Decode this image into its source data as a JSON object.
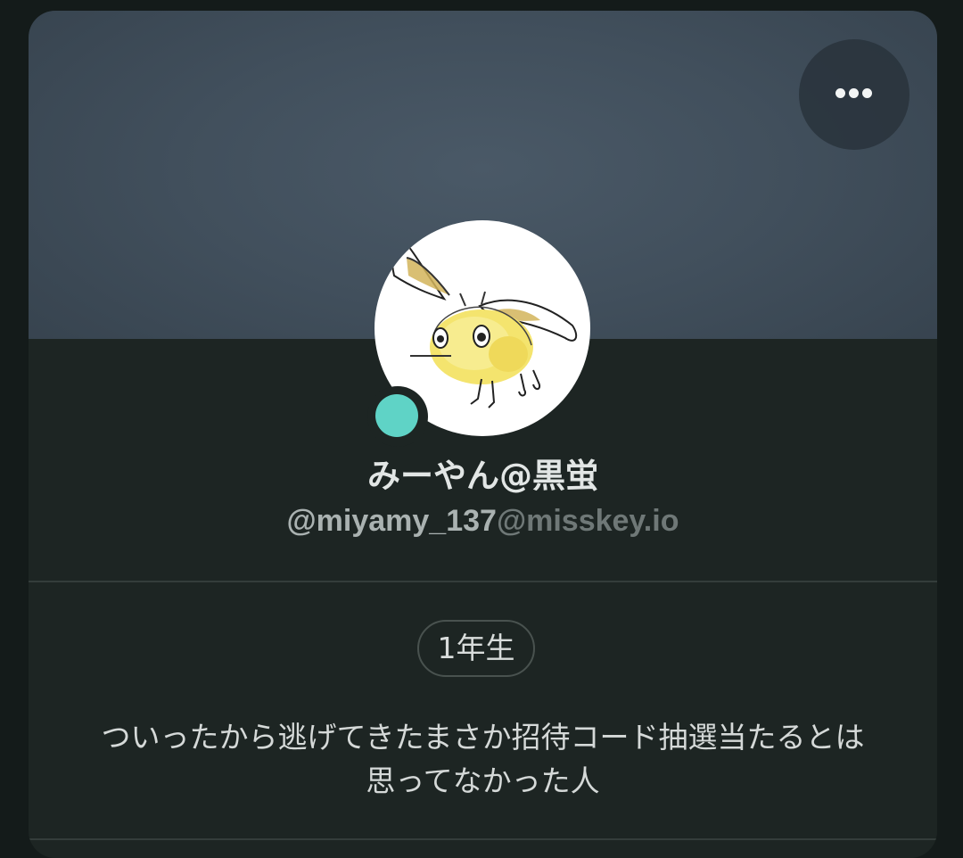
{
  "profile": {
    "display_name": "みーやん@黒蛍",
    "username": "@miyamy_137",
    "host": "@misskey.io",
    "role_badge": "1年生",
    "bio_line1": "ついったから逃げてきたまさか招待コード抽選当たるとは",
    "bio_line2": "思ってなかった人",
    "online_status_color": "#5fd3c6"
  },
  "banner": {
    "colors": [
      "#4a5967",
      "#34404b"
    ]
  },
  "menu": {
    "icon": "more-horizontal-icon"
  },
  "avatar": {
    "icon": "bee-drawing-avatar"
  }
}
